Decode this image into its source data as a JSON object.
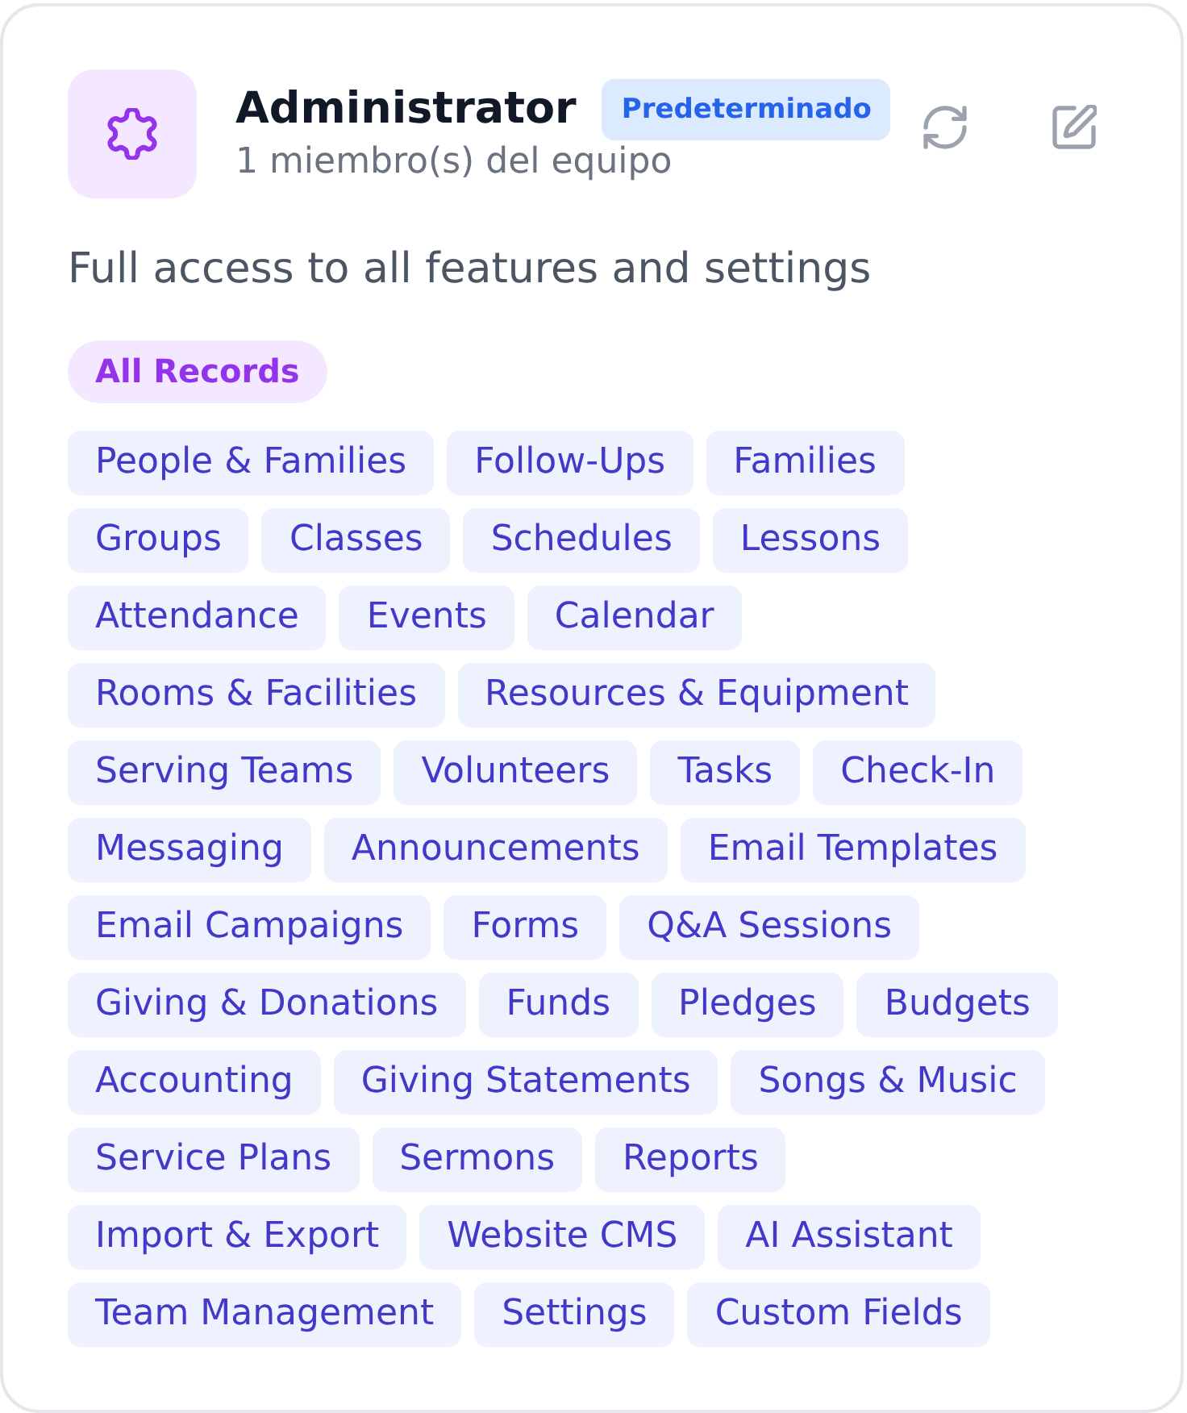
{
  "role": {
    "title": "Administrator",
    "badge": "Predeterminado",
    "members": "1 miembro(s) del equipo",
    "description": "Full access to all features and settings",
    "scope": "All Records",
    "permissions": [
      "People & Families",
      "Follow-Ups",
      "Families",
      "Groups",
      "Classes",
      "Schedules",
      "Lessons",
      "Attendance",
      "Events",
      "Calendar",
      "Rooms & Facilities",
      "Resources & Equipment",
      "Serving Teams",
      "Volunteers",
      "Tasks",
      "Check-In",
      "Messaging",
      "Announcements",
      "Email Templates",
      "Email Campaigns",
      "Forms",
      "Q&A Sessions",
      "Giving & Donations",
      "Funds",
      "Pledges",
      "Budgets",
      "Accounting",
      "Giving Statements",
      "Songs & Music",
      "Service Plans",
      "Sermons",
      "Reports",
      "Import & Export",
      "Website CMS",
      "AI Assistant",
      "Team Management",
      "Settings",
      "Custom Fields"
    ]
  }
}
